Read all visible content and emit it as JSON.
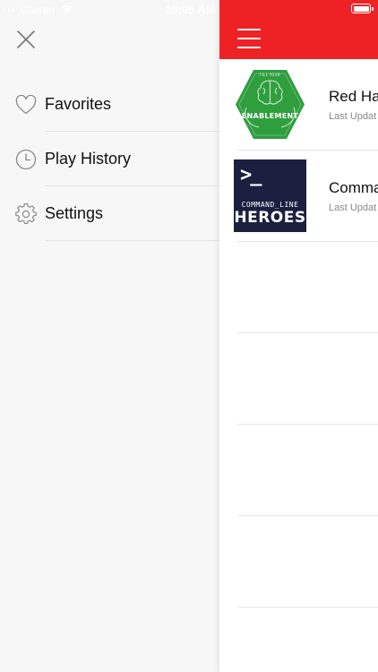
{
  "status_bar": {
    "carrier": "Carrier",
    "time": "10:05 AM"
  },
  "drawer": {
    "items": [
      {
        "label": "Favorites",
        "icon": "heart-icon"
      },
      {
        "label": "Play History",
        "icon": "clock-icon"
      },
      {
        "label": "Settings",
        "icon": "gear-icon"
      }
    ]
  },
  "podcasts": [
    {
      "title": "Red Hat",
      "subtitle": "Last Updat",
      "art": {
        "line1": "FILL YOUR",
        "line2": "ENABLEMENT"
      }
    },
    {
      "title": "Comma",
      "subtitle": "Last Updat",
      "art": {
        "prompt": ">_",
        "line1": "COMMAND_LINE",
        "line2": "HEROES"
      }
    }
  ],
  "colors": {
    "accent": "#ee2224",
    "drawer_bg": "#f7f7f7",
    "enablement_green": "#2f9e3f",
    "command_line_navy": "#1b2040"
  }
}
